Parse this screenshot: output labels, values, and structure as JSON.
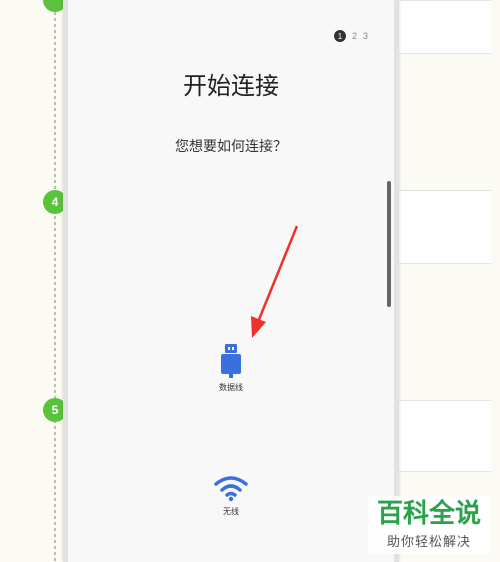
{
  "steps": [
    {
      "number": "4"
    },
    {
      "number": "5"
    }
  ],
  "screen": {
    "pager": {
      "current": "1",
      "p2": "2",
      "p3": "3"
    },
    "title": "开始连接",
    "subtitle": "您想要如何连接？",
    "options": [
      {
        "label": "数据线",
        "icon": "usb-icon"
      },
      {
        "label": "无线",
        "icon": "wifi-icon"
      }
    ]
  },
  "annotation": {
    "arrow_color": "#f0302a"
  },
  "colors": {
    "accent": "#3a6fe0",
    "step_green": "#5bc23c"
  },
  "watermark": {
    "main": "百科全说",
    "sub": "助你轻松解决"
  }
}
